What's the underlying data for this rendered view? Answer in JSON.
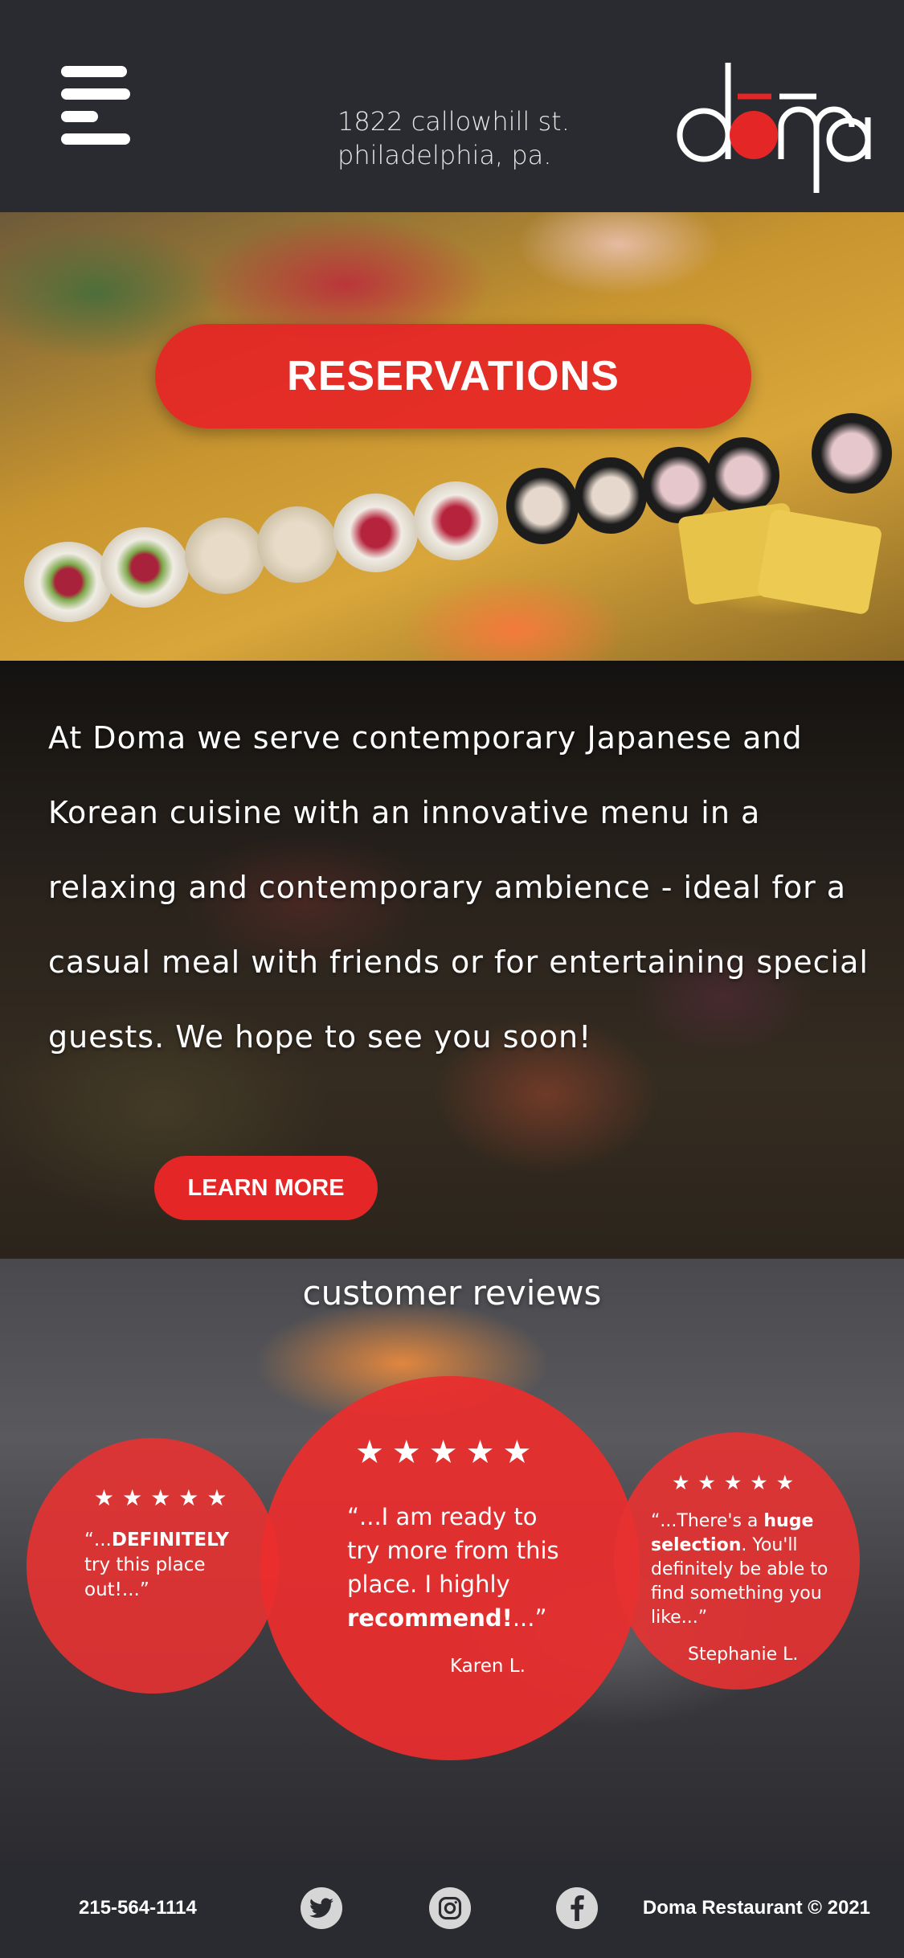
{
  "header": {
    "address_line1": "1822 callowhill st.",
    "address_line2": "philadelphia, pa.",
    "logo_text": "doma"
  },
  "hero": {
    "reservations_label": "RESERVATIONS"
  },
  "about": {
    "text": "At Doma we serve contemporary Japanese and Korean cuisine with an innovative menu in a relaxing and contemporary ambience - ideal for a casual meal with friends or for entertaining special guests. We hope to see you soon!",
    "learn_more_label": "LEARN MORE"
  },
  "reviews": {
    "title": "customer reviews",
    "items": [
      {
        "stars": "★★★★★",
        "quote_open": "“...",
        "quote_bold": "DEFINITELY",
        "quote_rest": " try this place out!...”",
        "author": ""
      },
      {
        "stars": "★★★★★",
        "quote_open": "“...I am ready to try more from this place. I highly ",
        "quote_bold": "recommend!",
        "quote_rest": "...”",
        "author": "Karen L."
      },
      {
        "stars": "★★★★★",
        "quote_open": "“...There's a ",
        "quote_bold": "huge selection",
        "quote_rest": ". You'll definitely be able to find something you like...”",
        "author": "Stephanie L."
      }
    ]
  },
  "footer": {
    "phone": "215-564-1114",
    "social": [
      "twitter-icon",
      "instagram-icon",
      "facebook-icon"
    ],
    "copyright": "Doma Restaurant © 2021"
  },
  "colors": {
    "background": "#2a2b30",
    "accent_red": "#e52626",
    "text": "#ffffff"
  }
}
